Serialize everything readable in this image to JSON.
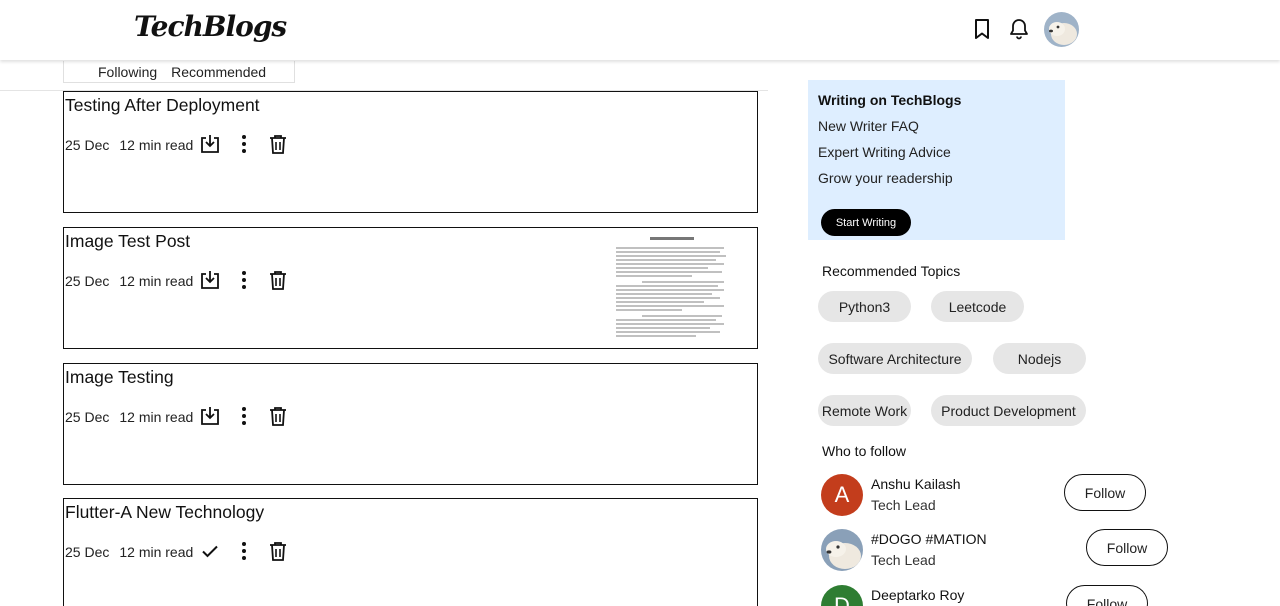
{
  "header": {
    "logo": "TechBlogs",
    "icons": [
      "bookmark-icon",
      "bell-icon",
      "avatar"
    ]
  },
  "tabs": [
    {
      "label": "Following"
    },
    {
      "label": "Recommended"
    }
  ],
  "posts": [
    {
      "title": "Testing After Deployment",
      "date": "25 Dec",
      "read_time": "12 min read",
      "saved": false
    },
    {
      "title": "Image Test Post",
      "date": "25 Dec",
      "read_time": "12 min read",
      "saved": false
    },
    {
      "title": "Image Testing",
      "date": "25 Dec",
      "read_time": "12 min read",
      "saved": false
    },
    {
      "title": "Flutter-A New Technology",
      "date": "25 Dec",
      "read_time": "12 min read",
      "saved": true
    }
  ],
  "sidebar": {
    "writing": {
      "title": "Writing on TechBlogs",
      "links": [
        "New Writer FAQ",
        "Expert Writing Advice",
        "Grow your readership"
      ],
      "button": "Start Writing"
    },
    "topics_title": "Recommended Topics",
    "topics": [
      "Python3",
      "Leetcode",
      "Software Architecture",
      "Nodejs",
      "Remote Work",
      "Product Development"
    ],
    "follow_title": "Who to follow",
    "people": [
      {
        "name": "Anshu Kailash",
        "role": "Tech Lead",
        "initial": "A",
        "color": "#c33d1c",
        "button": "Follow"
      },
      {
        "name": "#DOGO #MATION",
        "role": "Tech Lead",
        "initial": "",
        "color": "#8aa0b8",
        "button": "Follow"
      },
      {
        "name": "Deeptarko Roy",
        "role": "",
        "initial": "D",
        "color": "#2e7d32",
        "button": "Follow"
      }
    ]
  },
  "colors": {
    "writing_bg": "#deeeff",
    "chip_bg": "#e6e6e6",
    "button_dark": "#000000"
  }
}
